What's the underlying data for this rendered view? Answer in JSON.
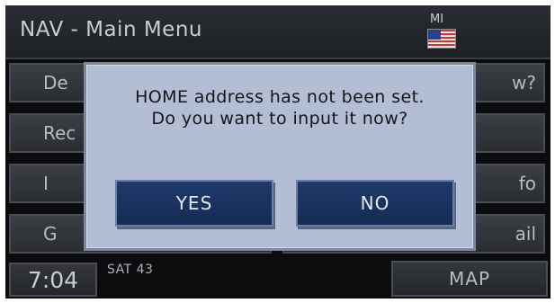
{
  "header": {
    "title": "NAV - Main Menu",
    "state_code": "MI",
    "flag_icon": "us-flag-icon"
  },
  "menu": {
    "left": [
      "De",
      "Rec",
      "I",
      "G"
    ],
    "right": [
      "w?",
      "",
      "fo",
      "ail"
    ]
  },
  "dialog": {
    "message": "HOME address has not been set. Do you want to input it now?",
    "yes_label": "YES",
    "no_label": "NO"
  },
  "footer": {
    "clock": "7:04",
    "radio_info": "SAT 43",
    "map_label": "MAP"
  },
  "colors": {
    "dialog_bg": "#b3bdd3",
    "dialog_button": "#1f3a6b",
    "screen_bg": "#0c0c0f"
  }
}
